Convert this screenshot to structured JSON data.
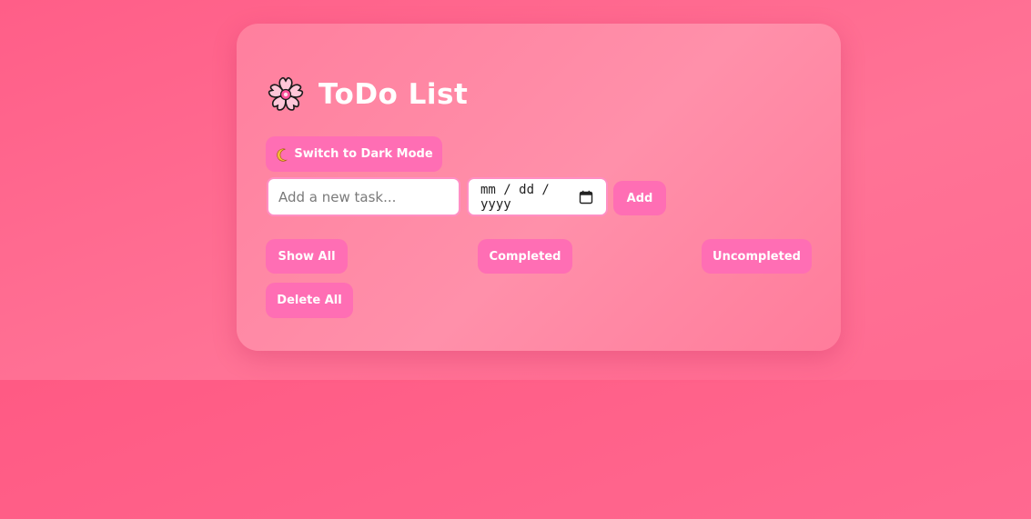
{
  "app": {
    "title": "ToDo List"
  },
  "theme_toggle": {
    "label": "Switch to Dark Mode"
  },
  "new_task": {
    "placeholder": "Add a new task...",
    "value": "",
    "date_placeholder": "mm / dd / yyyy",
    "add_label": "Add"
  },
  "filters": {
    "show_all": "Show All",
    "completed": "Completed",
    "uncompleted": "Uncompleted",
    "delete_all": "Delete All"
  },
  "icons": {
    "title": "cherry-blossom-icon",
    "theme": "crescent-moon-icon",
    "date": "calendar-icon"
  },
  "colors": {
    "background": "#ff6a91",
    "card": "#ff88a4",
    "button": "#ff6eb4",
    "input_border": "#ff8fc4",
    "text_light": "#ffffff"
  }
}
